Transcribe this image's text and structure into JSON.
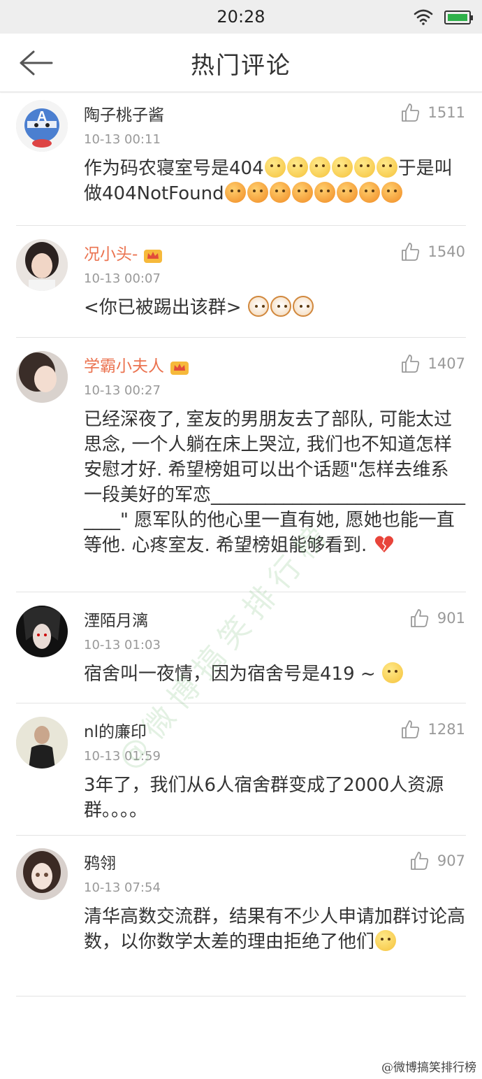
{
  "status_bar": {
    "time": "20:28"
  },
  "header": {
    "title": "热门评论"
  },
  "comments": [
    {
      "username": "陶子桃子酱",
      "vip": false,
      "timestamp": "10-13 00:11",
      "likes": "1511",
      "text_parts": [
        "作为码农寝室号是404",
        "于是叫做404NotFound"
      ]
    },
    {
      "username": "况小头-",
      "vip": true,
      "timestamp": "10-13 00:07",
      "likes": "1540",
      "text_parts": [
        "<你已被踢出该群> "
      ]
    },
    {
      "username": "学霸小夫人",
      "vip": true,
      "timestamp": "10-13 00:27",
      "likes": "1407",
      "text_parts": [
        "已经深夜了, 室友的男朋友去了部队, 可能太过思念, 一个人躺在床上哭泣, 我们也不知道怎样安慰才好. 希望榜姐可以出个话题\"怎样去维系一段美好的军恋________________________________\" 愿军队的他心里一直有她, 愿她也能一直等他. 心疼室友. 希望榜姐能够看到. "
      ]
    },
    {
      "username": "湮陌月漓",
      "vip": false,
      "timestamp": "10-13 01:03",
      "likes": "901",
      "text_parts": [
        "宿舍叫一夜情，因为宿舍号是419 ~ "
      ]
    },
    {
      "username": "nl的廉印",
      "vip": false,
      "timestamp": "10-13 01:59",
      "likes": "1281",
      "text_parts": [
        "3年了，我们从6人宿舍群变成了2000人资源群。。。。"
      ]
    },
    {
      "username": "鸦翎",
      "vip": false,
      "timestamp": "10-13 07:54",
      "likes": "907",
      "text_parts": [
        "清华高数交流群，结果有不少人申请加群讨论高数，以你数学太差的理由拒绝了他们"
      ]
    }
  ],
  "watermark": "@微博搞笑排行榜",
  "credit": "@微博搞笑排行榜",
  "colors": {
    "vip_name": "#eb7350",
    "meta": "#999999",
    "battery": "#2fb14a"
  }
}
